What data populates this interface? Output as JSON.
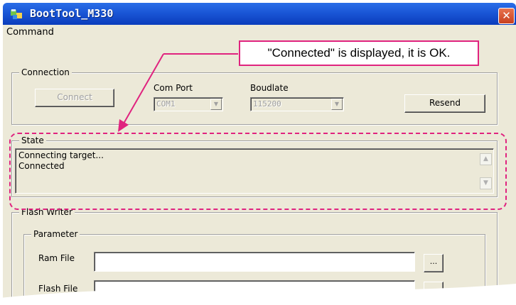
{
  "window": {
    "title": "BootTool_M330",
    "close_glyph": "✕"
  },
  "menu": {
    "items": [
      {
        "label": "Command"
      }
    ]
  },
  "connection": {
    "group_label": "Connection",
    "connect_label": "Connect",
    "com_port_label": "Com Port",
    "com_port_value": "COM1",
    "boudlate_label": "Boudlate",
    "boudlate_value": "115200",
    "resend_label": "Resend"
  },
  "state": {
    "group_label": "State",
    "lines": [
      "Connecting target...",
      "Connected"
    ]
  },
  "flash_writer": {
    "group_label": "Flash Writer",
    "parameter_label": "Parameter",
    "ram_file_label": "Ram File",
    "ram_file_value": "",
    "flash_file_label": "Flash File",
    "flash_file_value": "",
    "browse_label": "..."
  },
  "annotation": {
    "text": "\"Connected\" is displayed, it is OK.",
    "color": "#e0237f"
  },
  "colors": {
    "titlebar": "#1a56d6",
    "face": "#ece9d8",
    "close": "#d8542f"
  },
  "icons": [
    "app-icon",
    "close-icon",
    "scroll-up-icon",
    "scroll-down-icon",
    "dropdown-arrow-icon"
  ]
}
